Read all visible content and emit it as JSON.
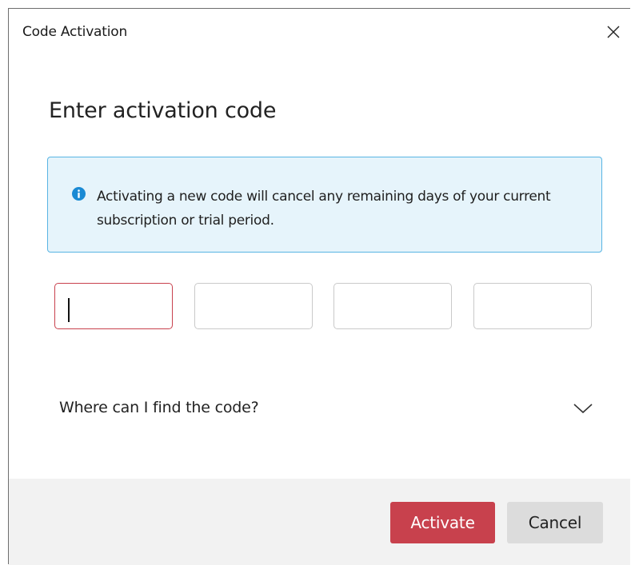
{
  "window": {
    "title": "Code Activation"
  },
  "heading": "Enter activation code",
  "info": {
    "icon": "info-icon",
    "text": "Activating a new code will cancel any remaining days of your current subscription or trial period."
  },
  "code_fields": [
    {
      "value": "",
      "focused": true
    },
    {
      "value": "",
      "focused": false
    },
    {
      "value": "",
      "focused": false
    },
    {
      "value": "",
      "focused": false
    }
  ],
  "faq": {
    "label": "Where can I find the code?",
    "expanded": false
  },
  "buttons": {
    "activate_label": "Activate",
    "cancel_label": "Cancel"
  },
  "colors": {
    "accent": "#c8414d",
    "info_background": "#e6f4fb",
    "info_border": "#58b4e3",
    "info_icon": "#1a8ad4",
    "footer_background": "#f2f2f2",
    "cancel_background": "#dcdcdc"
  }
}
